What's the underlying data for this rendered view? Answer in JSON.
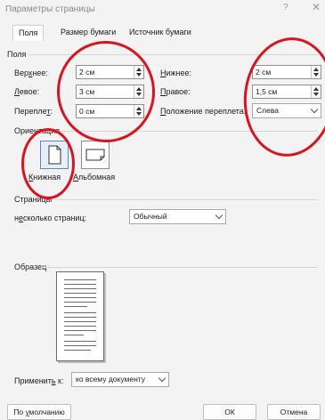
{
  "window": {
    "title": "Параметры страницы",
    "help": "?",
    "close": "✕"
  },
  "tabs": [
    {
      "label": "Поля",
      "active": true
    },
    {
      "label": "Размер бумаги",
      "active": false
    },
    {
      "label": "Источник бумаги",
      "active": false
    }
  ],
  "margins": {
    "group_label": "Поля",
    "top": {
      "label_pre": "Вер",
      "label_u": "х",
      "label_post": "нее:",
      "value": "2 см"
    },
    "left": {
      "label_pre": "",
      "label_u": "Л",
      "label_post": "евое:",
      "value": "3 см"
    },
    "gutter": {
      "label_pre": "Перепле",
      "label_u": "т",
      "label_post": ":",
      "value": "0 см"
    },
    "bottom": {
      "label_pre": "",
      "label_u": "Н",
      "label_post": "ижнее:",
      "value": "2 см"
    },
    "right": {
      "label_pre": "",
      "label_u": "П",
      "label_post": "равое:",
      "value": "1,5 см"
    },
    "gutter_pos": {
      "label_pre": "",
      "label_u": "П",
      "label_post": "оложение переплета:",
      "value": "Слева"
    }
  },
  "orientation": {
    "group_label": "Ориентация",
    "portrait": {
      "label_pre": "",
      "label_u": "К",
      "label_post": "нижная",
      "selected": true
    },
    "landscape": {
      "label_pre": "",
      "label_u": "А",
      "label_post": "льбомная",
      "selected": false
    }
  },
  "pages": {
    "group_label": "Страницы",
    "multiple_label_pre": "н",
    "multiple_label_u": "е",
    "multiple_label_post": "сколько страниц:",
    "multiple_value": "Обычный"
  },
  "preview": {
    "group_label": "Образец"
  },
  "apply": {
    "label_pre": "Применит",
    "label_u": "ь",
    "label_post": " к:",
    "value": "ко всему документу"
  },
  "buttons": {
    "default_pre": "По ",
    "default_u": "у",
    "default_post": "молчанию",
    "ok": "ОК",
    "cancel": "Отмена"
  }
}
